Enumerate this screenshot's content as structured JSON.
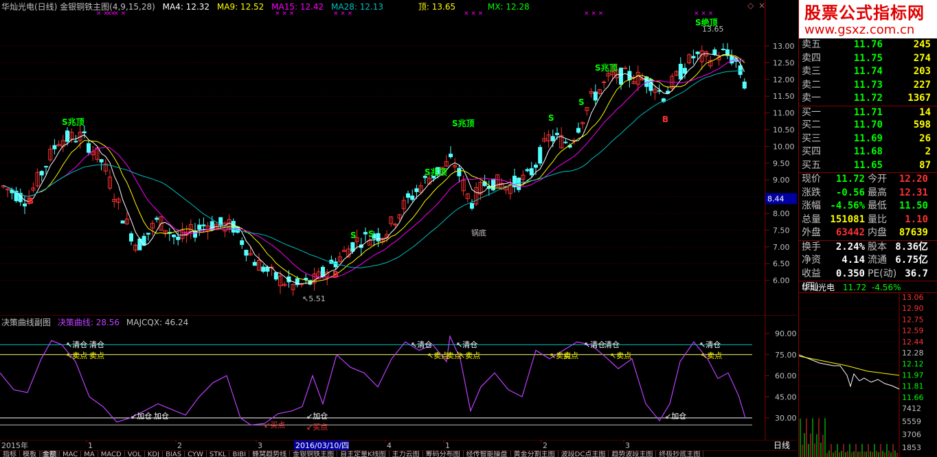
{
  "header": {
    "title": "华灿光电(日线) 金银铜铁主图(4,9,15,28)",
    "ma4": "MA4: 12.32",
    "ma9": "MA9: 12.52",
    "ma15": "MA15: 12.42",
    "ma28": "MA28: 12.13",
    "top": "顶: 13.65",
    "mx": "MX: 12.28"
  },
  "sub_header": {
    "title": "决策曲线副图",
    "curve": "决策曲线: 28.56",
    "majcqx": "MAJCQX: 46.24"
  },
  "colors": {
    "up": "#ff3232",
    "down": "#54ffff",
    "ma4": "#ffffff",
    "ma9": "#ffff00",
    "ma15": "#ff00ff",
    "ma28": "#00c0c0",
    "curve": "#c040ff",
    "signal_green": "#00ff00",
    "signal_red": "#ff3232",
    "brand": "#e00000"
  },
  "price_axis": {
    "labels": [
      "13.00",
      "12.50",
      "12.00",
      "11.50",
      "11.00",
      "10.50",
      "10.00",
      "9.50",
      "9.00",
      "8.50",
      "8.00",
      "7.50",
      "7.00",
      "6.50",
      "6.00"
    ],
    "current_marker": "8.44"
  },
  "sub_axis": {
    "labels": [
      "90.00",
      "75.00",
      "60.00",
      "45.00",
      "30.00"
    ]
  },
  "time_axis": {
    "labels": [
      "2015年",
      "1",
      "2",
      "3",
      "4",
      "1",
      "2",
      "3"
    ],
    "cursor_date": "2016/03/10/四"
  },
  "annotations": {
    "top_signal": "S绝顶",
    "top_value": "13.65",
    "low_value": "5.51",
    "zhaoding": "S兆顶",
    "s": "S",
    "b": "B",
    "guodi": "锅底",
    "qingcang": "清仓",
    "maidian": "卖点",
    "jiacang": "加仓",
    "maidian_buy": "买点"
  },
  "bottom_tabs": [
    "指标",
    "模板",
    "金额",
    "MAC",
    "MA",
    "MACD",
    "VOL",
    "KDJ",
    "BIAS",
    "CYW",
    "STKL",
    "BIBI",
    "蜂窝趋势线",
    "金银铜铁主图",
    "自主定量K线图",
    "主力云图",
    "筹码分布图",
    "经传智能操盘",
    "黄金分割主图",
    "波段DC点主图",
    "趋势波段主图",
    "终极抄底主图"
  ],
  "period": "日线",
  "right_panel": {
    "logo_main": "股票公式指标网",
    "logo_url": "www.gsxz.com.cn",
    "order_book": [
      {
        "label": "卖五",
        "price": "11.76",
        "vol": "245"
      },
      {
        "label": "卖四",
        "price": "11.75",
        "vol": "274"
      },
      {
        "label": "卖三",
        "price": "11.74",
        "vol": "203"
      },
      {
        "label": "卖二",
        "price": "11.73",
        "vol": "227"
      },
      {
        "label": "卖一",
        "price": "11.72",
        "vol": "1367"
      },
      {
        "label": "买一",
        "price": "11.71",
        "vol": "14"
      },
      {
        "label": "买二",
        "price": "11.70",
        "vol": "598"
      },
      {
        "label": "买三",
        "price": "11.69",
        "vol": "26"
      },
      {
        "label": "买四",
        "price": "11.68",
        "vol": "2"
      },
      {
        "label": "买五",
        "price": "11.65",
        "vol": "87"
      }
    ],
    "stats": [
      {
        "k1": "现价",
        "v1": "11.72",
        "k2": "今开",
        "v2": "12.20"
      },
      {
        "k1": "涨跌",
        "v1": "-0.56",
        "k2": "最高",
        "v2": "12.31"
      },
      {
        "k1": "涨幅",
        "v1": "-4.56%",
        "k2": "最低",
        "v2": "11.50"
      },
      {
        "k1": "总量",
        "v1": "151081",
        "k2": "量比",
        "v2": "1.10"
      },
      {
        "k1": "外盘",
        "v1": "63442",
        "k2": "内盘",
        "v2": "87639"
      }
    ],
    "stats2": [
      {
        "k1": "换手",
        "v1": "2.24%",
        "k2": "股本",
        "v2": "8.36亿"
      },
      {
        "k1": "净资",
        "v1": "4.14",
        "k2": "流通",
        "v2": "6.75亿"
      },
      {
        "k1": "收益(四)",
        "v1": "0.350",
        "k2": "PE(动)",
        "v2": "36.7"
      }
    ],
    "mini_header": {
      "name": "华灿光电",
      "price": "11.72",
      "change": "-4.56%"
    },
    "mini_axis": [
      "13.06",
      "12.90",
      "12.75",
      "12.59",
      "12.44",
      "12.28",
      "12.12",
      "11.97",
      "11.81",
      "11.66"
    ],
    "mini_vol_axis": [
      "7412",
      "5559",
      "3706",
      "1853"
    ]
  }
}
